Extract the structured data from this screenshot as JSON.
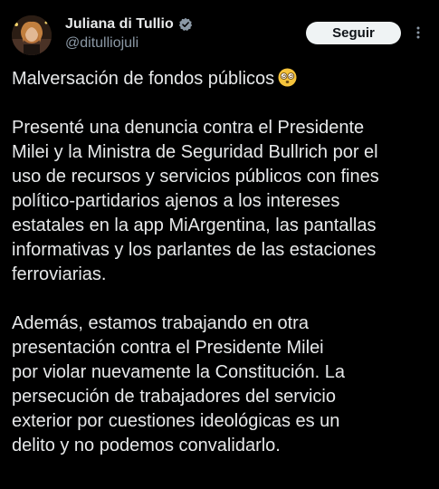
{
  "author": {
    "display_name": "Juliana di Tullio",
    "handle": "@ditulliojuli",
    "verified": true,
    "avatar_icon": "profile-photo-avatar",
    "verified_icon": "verified-badge-icon"
  },
  "actions": {
    "follow_label": "Seguir",
    "more_icon": "more-options-icon"
  },
  "tweet": {
    "title_line": "Malversación de fondos públicos",
    "title_emoji": "dizzy-face-emoji",
    "paragraph_1": [
      "Presenté una denuncia contra el Presidente",
      "Milei y la Ministra de Seguridad Bullrich por el",
      "uso de recursos y servicios públicos con fines",
      "político-partidarios ajenos a los intereses",
      "estatales en la app MiArgentina, las pantallas",
      "informativas y los parlantes de las estaciones",
      "ferroviarias."
    ],
    "paragraph_2": [
      "Además, estamos trabajando en otra",
      "presentación contra el Presidente Milei",
      "por violar nuevamente la Constitución. La",
      "persecución de trabajadores del servicio",
      "exterior por cuestiones ideológicas es un",
      "delito y no podemos convalidarlo."
    ]
  },
  "colors": {
    "background": "#000000",
    "text_primary": "#e7e9ea",
    "text_secondary": "#8b98a5",
    "follow_bg": "#eff3f4",
    "verified_badge": "#8b98a5"
  }
}
